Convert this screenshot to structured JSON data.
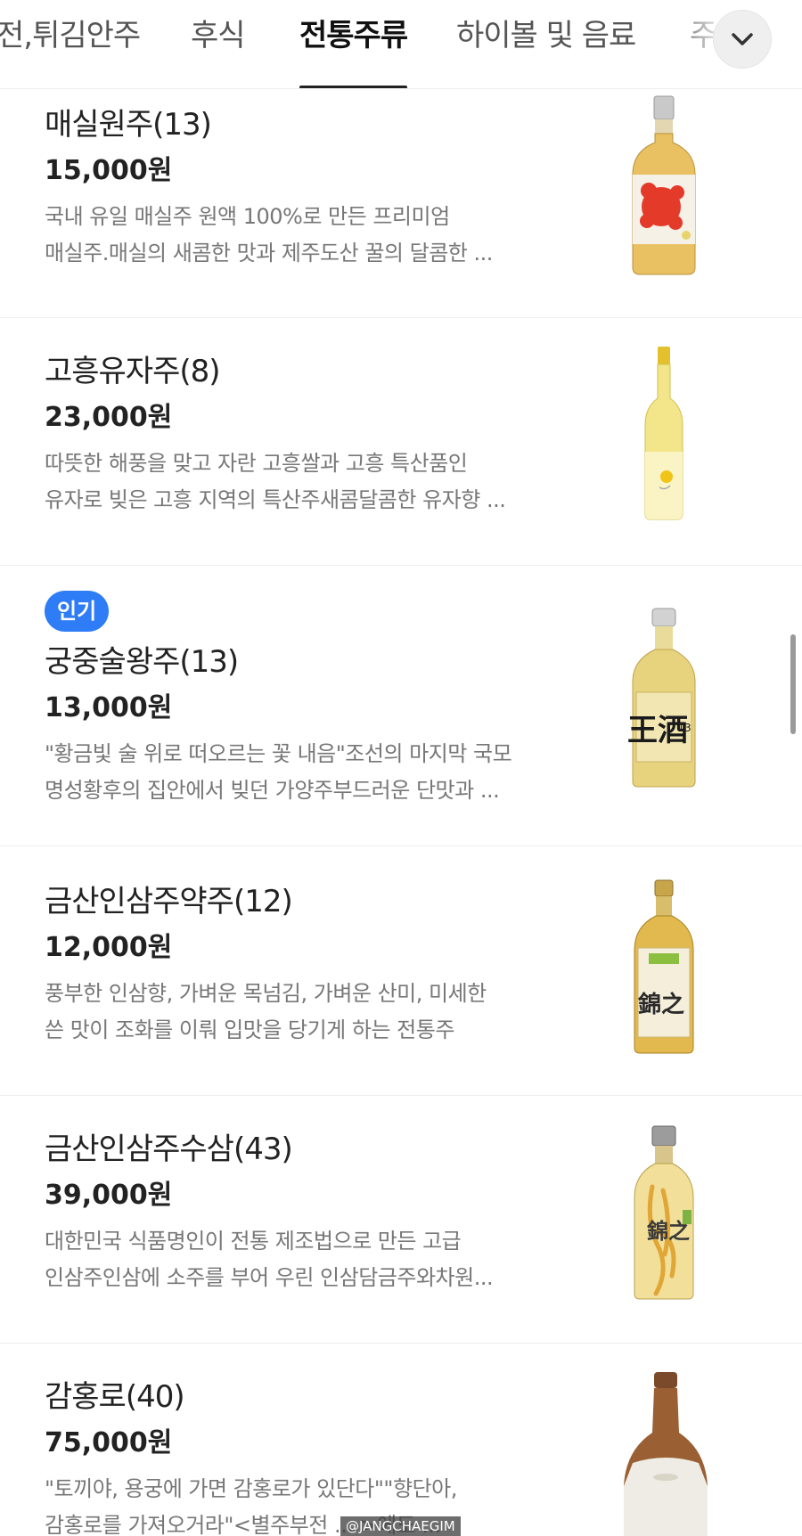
{
  "tabs": [
    {
      "label": "전,튀김안주",
      "active": false
    },
    {
      "label": "후식",
      "active": false
    },
    {
      "label": "전통주류",
      "active": true
    },
    {
      "label": "하이볼 및 음료",
      "active": false
    },
    {
      "label": "주",
      "active": false
    }
  ],
  "menu_items": [
    {
      "name": "매실원주(13)",
      "price": "15,000원",
      "badge": "",
      "desc": [
        "국내 유일 매실주 원액 100%로 만든 프리미엄",
        "매실주.매실의 새콤한 맛과 제주도산 꿀의 달콤한 ..."
      ],
      "image": "maesil-wonju-bottle-icon"
    },
    {
      "name": "고흥유자주(8)",
      "price": "23,000원",
      "badge": "",
      "desc": [
        "따뜻한 해풍을 맞고 자란 고흥쌀과 고흥 특산품인",
        "유자로 빚은 고흥 지역의 특산주새콤달콤한 유자향 ..."
      ],
      "image": "yuja-ju-bottle-icon"
    },
    {
      "name": "궁중술왕주(13)",
      "price": "13,000원",
      "badge": "인기",
      "desc": [
        "\"황금빛 술 위로 떠오르는 꽃 내음\"조선의 마지막 국모",
        "명성황후의 집안에서 빚던 가양주부드러운 단맛과 ..."
      ],
      "image": "wangju-bottle-icon"
    },
    {
      "name": "금산인삼주약주(12)",
      "price": "12,000원",
      "badge": "",
      "desc": [
        "풍부한 인삼향, 가벼운 목넘김,  가벼운 산미, 미세한",
        "쓴 맛이 조화를 이뤄 입맛을 당기게 하는 전통주"
      ],
      "image": "insamju-yakju-bottle-icon"
    },
    {
      "name": "금산인삼주수삼(43)",
      "price": "39,000원",
      "badge": "",
      "desc": [
        "대한민국 식품명인이 전통 제조법으로 만든 고급",
        "인삼주인삼에 소주를 부어 우린 인삼담금주와차원..."
      ],
      "image": "insamju-susam-bottle-icon"
    },
    {
      "name": "감홍로(40)",
      "price": "75,000원",
      "badge": "",
      "desc": [
        "\"토끼야, 용궁에 가면 감홍로가 있단다\"\"향단아,",
        "감홍로를 가져오거라\"<별주부전 ... >에도 ..."
      ],
      "image": "gamhongro-bottle-icon"
    }
  ],
  "bottle_labels": {
    "wangju_text": "王酒",
    "wangju_number": "13",
    "insam_text": "錦之"
  },
  "watermark": "@JANGCHAEGIM",
  "colors": {
    "badge_blue": "#2e7cf6",
    "active_tab_underline": "#222222",
    "desc_gray": "#777777"
  }
}
